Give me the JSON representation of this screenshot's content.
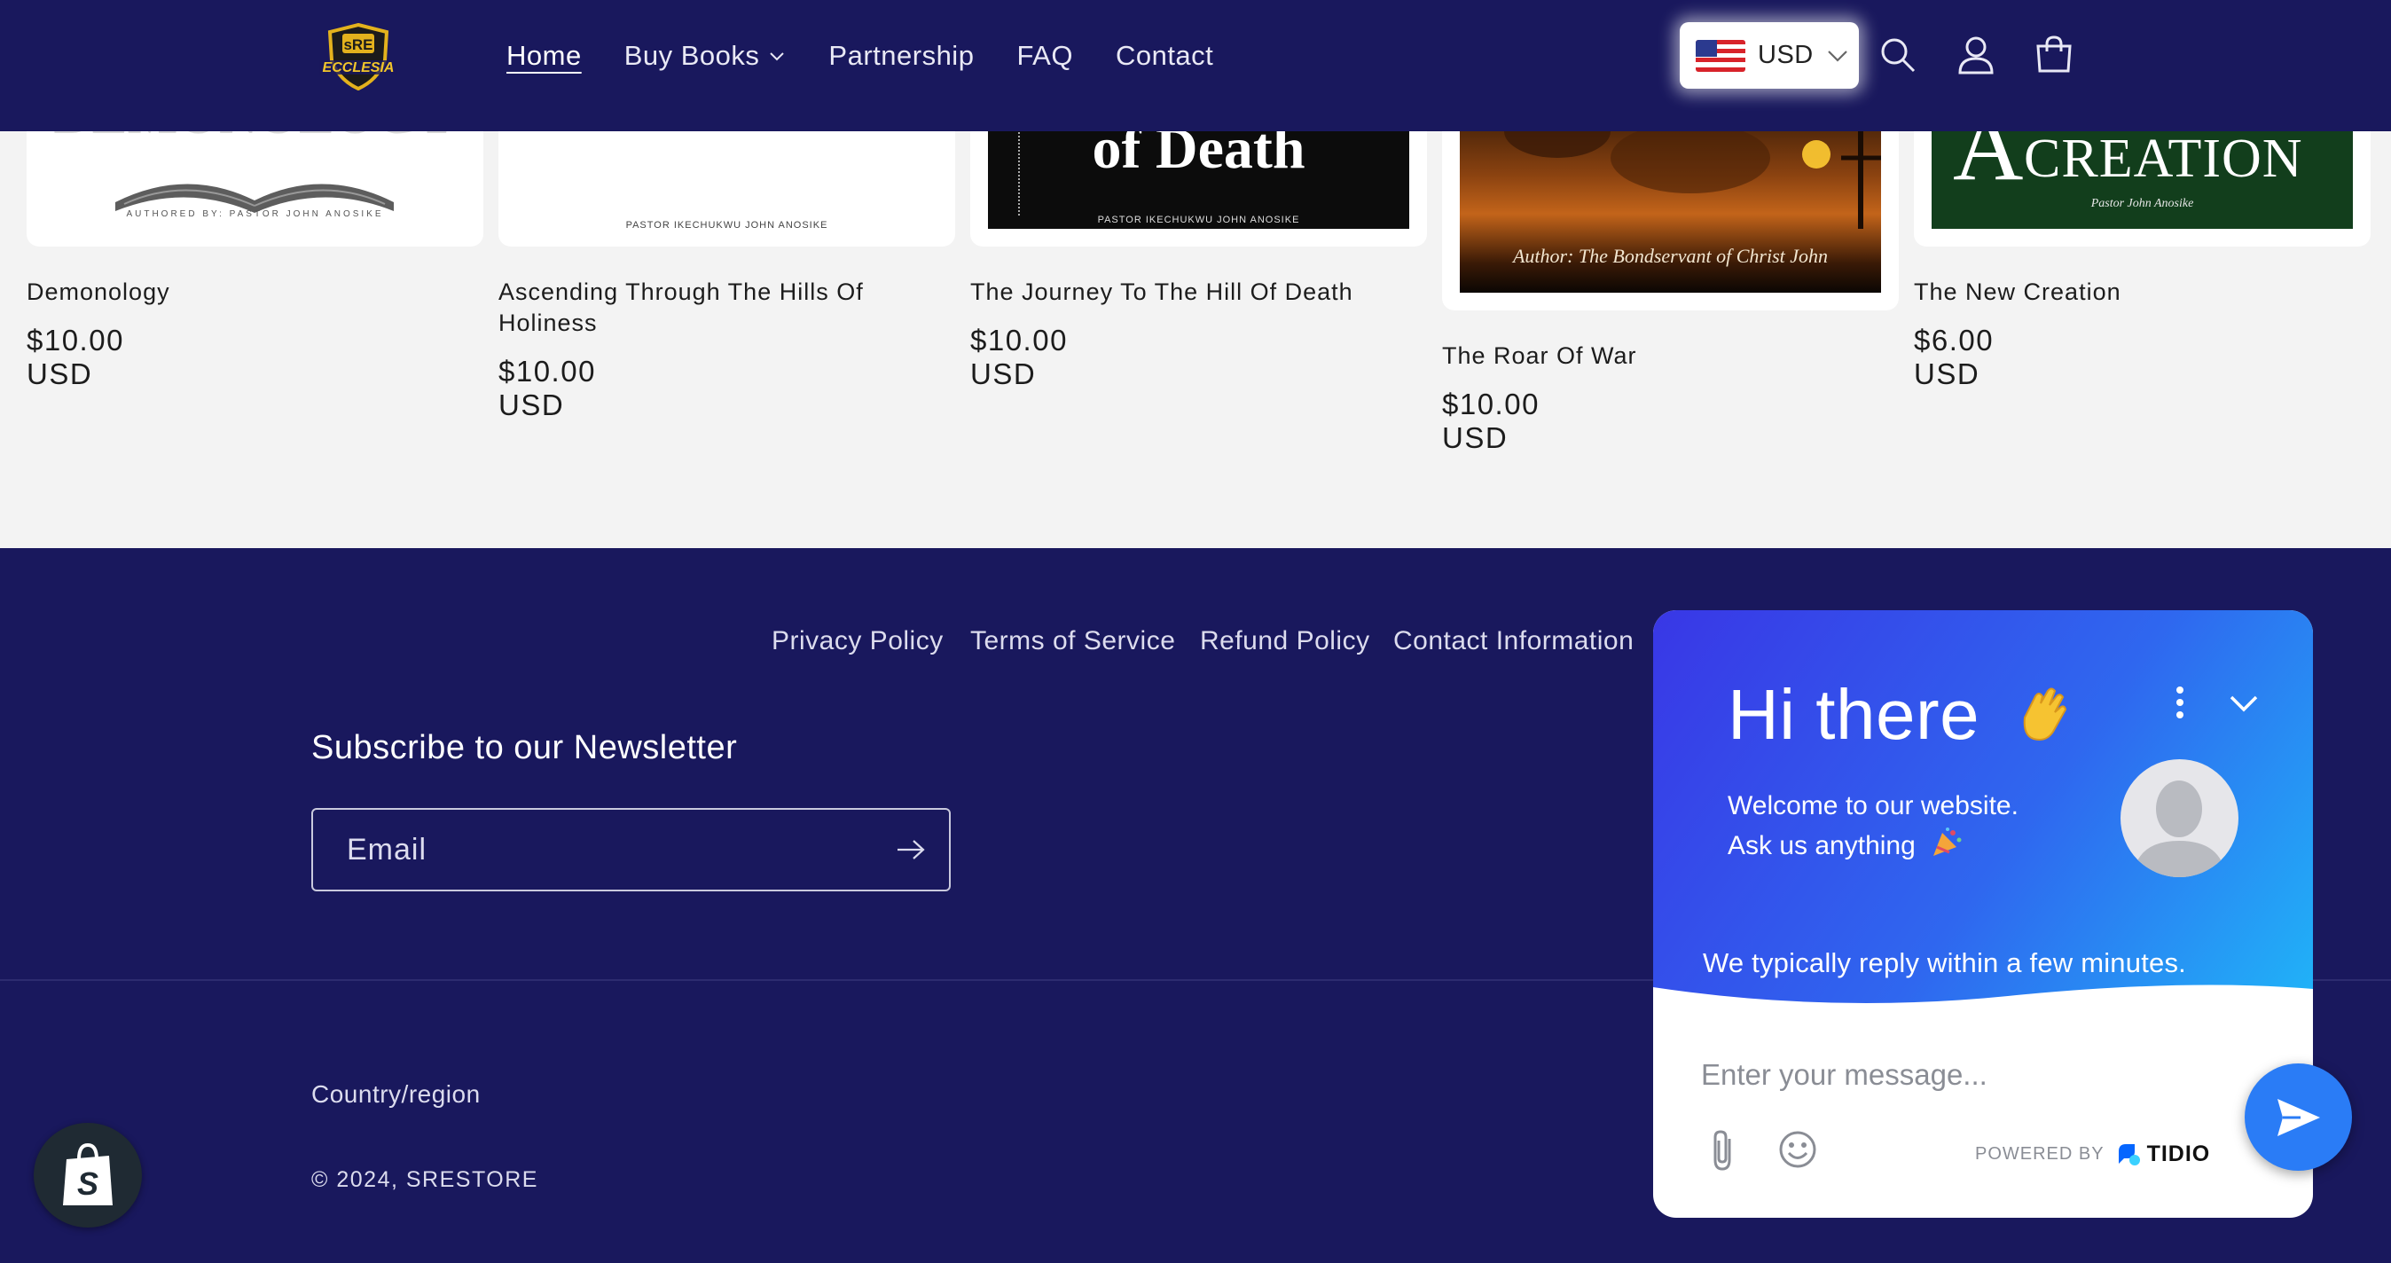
{
  "header": {
    "nav": [
      {
        "label": "Home",
        "active": true
      },
      {
        "label": "Buy Books",
        "has_dropdown": true
      },
      {
        "label": "Partnership"
      },
      {
        "label": "FAQ"
      },
      {
        "label": "Contact"
      }
    ],
    "currency": "USD",
    "icons": [
      "search-icon",
      "account-icon",
      "cart-icon"
    ],
    "colors": {
      "header_bg": "#19185d"
    }
  },
  "products": [
    {
      "title": "Demonology",
      "price": "$10.00 USD",
      "cover_text": "AUTHORED BY: PASTOR JOHN ANOSIKE"
    },
    {
      "title": "Ascending Through The Hills Of Holiness",
      "price": "$10.00 USD",
      "cover_text": "PASTOR IKECHUKWU JOHN ANOSIKE"
    },
    {
      "title": "The Journey To The Hill Of Death",
      "price": "$10.00 USD",
      "cover_heading": "of Death",
      "cover_text": "PASTOR IKECHUKWU JOHN ANOSIKE"
    },
    {
      "title": "The Roar Of War",
      "price": "$10.00 USD",
      "cover_text": "Author: The Bondservant of Christ John"
    },
    {
      "title": "The New Creation",
      "price": "$6.00 USD",
      "cover_heading": "CREATION",
      "cover_initial": "A",
      "cover_text": "Pastor John Anosike"
    }
  ],
  "footer": {
    "policies": [
      "Privacy Policy",
      "Terms of Service",
      "Refund Policy",
      "Contact Information"
    ],
    "newsletter_title": "Subscribe to our Newsletter",
    "email_placeholder": "Email",
    "country_label": "Country/region",
    "copyright_prefix": "© 2024, ",
    "copyright_brand": "SRESTORE",
    "colors": {
      "footer_bg": "#19185d"
    }
  },
  "chat": {
    "greeting": "Hi there",
    "welcome_line1": "Welcome to our website.",
    "welcome_line2": "Ask us anything",
    "reply_note": "We typically reply within a few minutes.",
    "message_placeholder": "Enter your message...",
    "powered_by": "POWERED BY",
    "brand": "TIDIO"
  }
}
